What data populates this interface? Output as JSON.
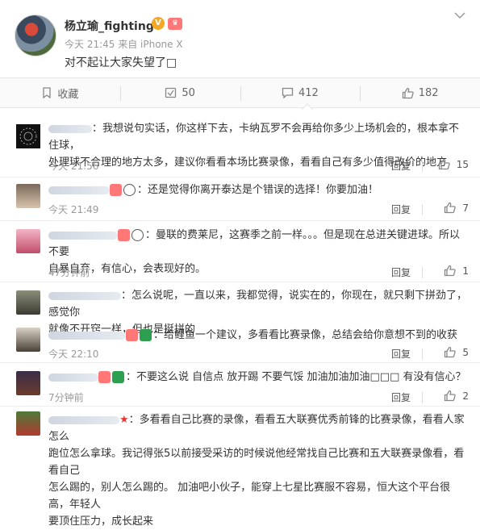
{
  "post": {
    "author": "杨立瑜_fighting",
    "meta": "今天 21:45 来自 iPhone X",
    "text": "对不起让大家失望了□"
  },
  "actions": [
    {
      "label": "收藏",
      "icon": "bookmark-icon"
    },
    {
      "label": "50",
      "icon": "repost-icon"
    },
    {
      "label": "412",
      "icon": "comment-icon"
    },
    {
      "label": "182",
      "icon": "like-icon"
    }
  ],
  "comments": [
    {
      "name": "L",
      "line1": "：我想说句实话，你这样下去，卡纳瓦罗不会再给你多少上场机会的，根本拿不住球，",
      "line2": "处理球不合理的地方太多，建议你看看本场比赛录像，看看自己有多少值得改价的地方",
      "time": "今天 21:56",
      "reply": "回复",
      "likes": "15"
    },
    {
      "name": "",
      "line1": "：还是觉得你离开泰达是个错误的选择！你要加油！",
      "line2": "",
      "time": "今天 21:49",
      "reply": "回复",
      "likes": "7"
    },
    {
      "name": "",
      "line1": "：曼联的费莱尼，这赛季之前一样。。。但是现在总进关键进球。所以不要",
      "line2": "自暴自弃，有信心，会表现好的。",
      "time": "47分钟前",
      "reply": "回复",
      "likes": "1"
    },
    {
      "name": "",
      "line1": "：怎么说呢，一直以来，我都觉得，说实在的，你现在，就只剩下拼劲了，感觉你",
      "line2": "就像不开窍一样，但也是挺拼的",
      "time": "",
      "reply": "",
      "likes": ""
    },
    {
      "name": "",
      "line1": "：给鲤鱼一个建议，多看看比赛录像，总结会给你意想不到的收获",
      "line2": "",
      "time": "今天 22:10",
      "reply": "回复",
      "likes": "5"
    },
    {
      "name": "",
      "line1": "：不要这么说  自信点 放开踢  不要气馁  加油加油加油□□□  有没有信心？",
      "line2": "",
      "time": "7分钟前",
      "reply": "回复",
      "likes": "2"
    },
    {
      "name": "",
      "line1": "：多看看自己比赛的录像，看看五大联赛优秀前锋的比赛录像，看看人家怎么",
      "line2": "跑位怎么拿球。我记得张5以前接受采访的时候说他经常找自己比赛和五大联赛录像看，看看自己",
      "line3": "怎么踢的，别人怎么踢的。 加油吧小伙子，能穿上七星比赛服不容易，恒大这个平台很高，年轻人",
      "line4": "要顶住压力，成长起来",
      "time": "",
      "reply": "",
      "likes": ""
    }
  ]
}
